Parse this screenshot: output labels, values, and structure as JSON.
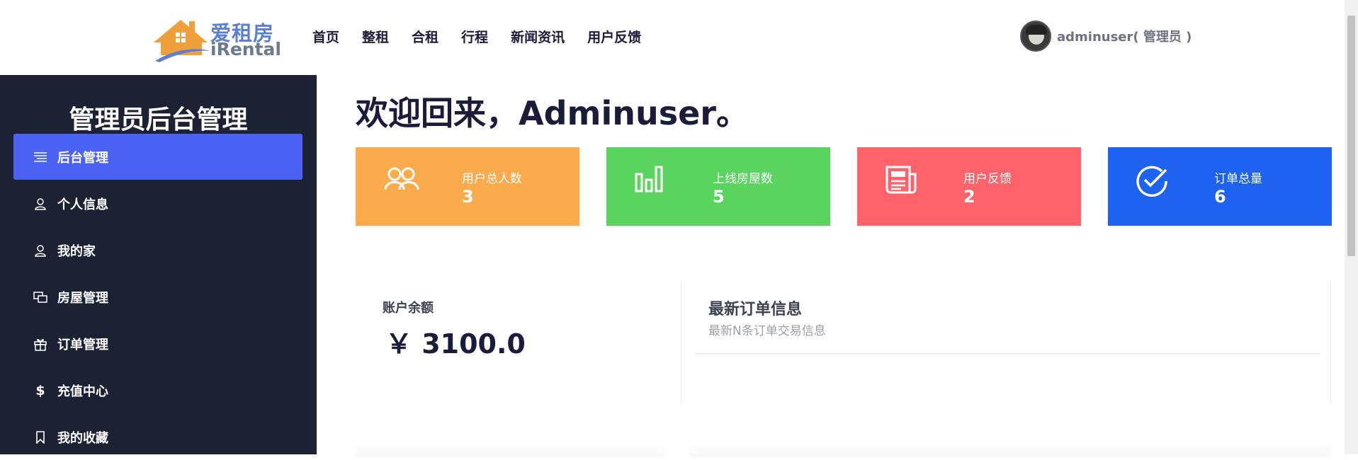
{
  "brand": {
    "name_cn": "爱租房",
    "name_en": "iRental",
    "colors": {
      "house": "#f0a03a",
      "swoosh": "#5b7fd6"
    }
  },
  "nav": {
    "items": [
      "首页",
      "整租",
      "合租",
      "行程",
      "新闻资讯",
      "用户反馈"
    ]
  },
  "user": {
    "display": "adminuser( 管理员 )"
  },
  "sidebar": {
    "title": "管理员后台管理",
    "items": [
      {
        "label": "后台管理",
        "icon": "menu-lines-icon",
        "active": true
      },
      {
        "label": "个人信息",
        "icon": "user-icon",
        "active": false
      },
      {
        "label": "我的家",
        "icon": "user-icon",
        "active": false
      },
      {
        "label": "房屋管理",
        "icon": "windows-icon",
        "active": false
      },
      {
        "label": "订单管理",
        "icon": "gift-icon",
        "active": false
      },
      {
        "label": "充值中心",
        "icon": "dollar-icon",
        "active": false
      },
      {
        "label": "我的收藏",
        "icon": "bookmark-icon",
        "active": false
      }
    ],
    "colors": {
      "background": "#1c2133",
      "active": "#4b62f5"
    }
  },
  "main": {
    "welcome": "欢迎回来，Adminuser。",
    "stats": [
      {
        "label": "用户总人数",
        "value": "3",
        "icon": "users-icon",
        "color": "#fbab4b"
      },
      {
        "label": "上线房屋数",
        "value": "5",
        "icon": "bar-chart-icon",
        "color": "#5ad35f"
      },
      {
        "label": "用户反馈",
        "value": "2",
        "icon": "newspaper-icon",
        "color": "#fe636c"
      },
      {
        "label": "订单总量",
        "value": "6",
        "icon": "check-circle-icon",
        "color": "#1e63f0"
      }
    ],
    "balance": {
      "label": "账户余额",
      "value": "￥ 3100.0"
    },
    "orders": {
      "title": "最新订单信息",
      "subtitle": "最新N条订单交易信息"
    }
  }
}
